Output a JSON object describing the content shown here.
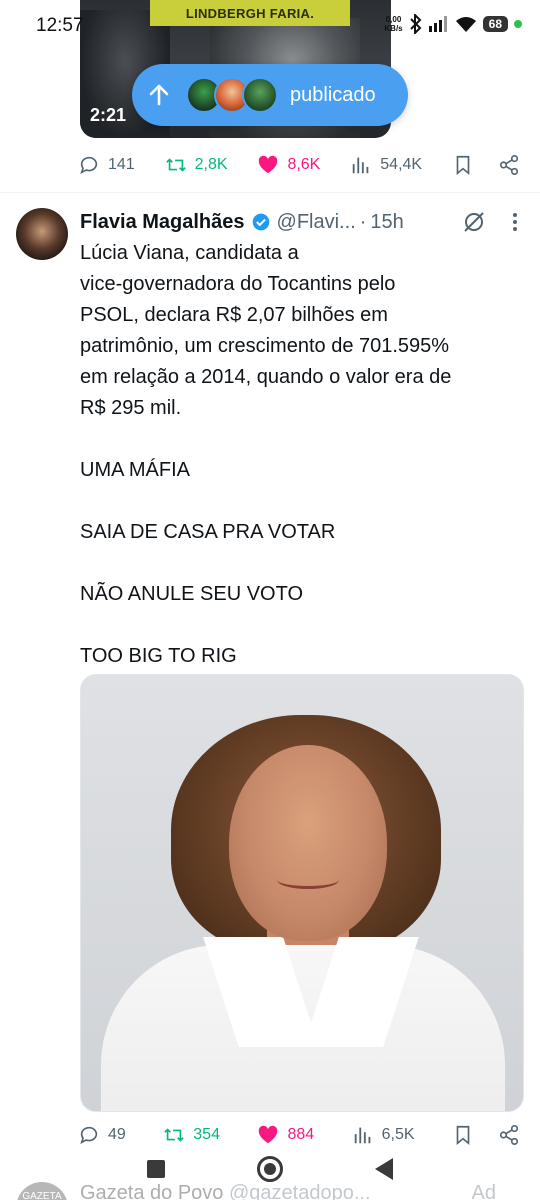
{
  "status_bar": {
    "time": "12:57",
    "net_speed_top": "0,00",
    "net_speed_bottom": "KB/s",
    "battery": "68"
  },
  "previous_tweet": {
    "media_banner": "LINDBERGH FARIA.",
    "video_duration": "2:21",
    "published_label": "publicado",
    "stats": {
      "replies": "141",
      "retweets": "2,8K",
      "likes": "8,6K",
      "views": "54,4K"
    }
  },
  "tweet": {
    "author_name": "Flavia Magalhães",
    "author_handle": "@Flavi...",
    "separator": "·",
    "time": "15h",
    "body": [
      "Lúcia Viana, candidata a",
      "vice-governadora do Tocantins pelo",
      "PSOL, declara R$ 2,07 bilhões em",
      "patrimônio, um crescimento de 701.595%",
      "em relação a 2014, quando o valor era de",
      "R$ 295 mil."
    ],
    "lines": [
      "UMA MÁFIA",
      "SAIA DE CASA PRA VOTAR",
      "NÃO ANULE SEU VOTO",
      "TOO BIG TO RIG"
    ],
    "stats": {
      "replies": "49",
      "retweets": "354",
      "likes": "884",
      "views": "6,5K"
    }
  },
  "next_tweet": {
    "avatar_text": "GAZETA",
    "author_name": "Gazeta do Povo",
    "author_handle": "@gazetadopo...",
    "ad_label": "Ad"
  },
  "colors": {
    "accent": "#1d9bf0",
    "retweet": "#00ba7c",
    "like": "#f91880",
    "muted": "#536471",
    "pill": "#4a9ff0"
  },
  "icons": [
    "reply-icon",
    "retweet-icon",
    "heart-icon",
    "views-icon",
    "bookmark-icon",
    "share-icon",
    "verified-icon",
    "grok-icon",
    "more-icon"
  ]
}
